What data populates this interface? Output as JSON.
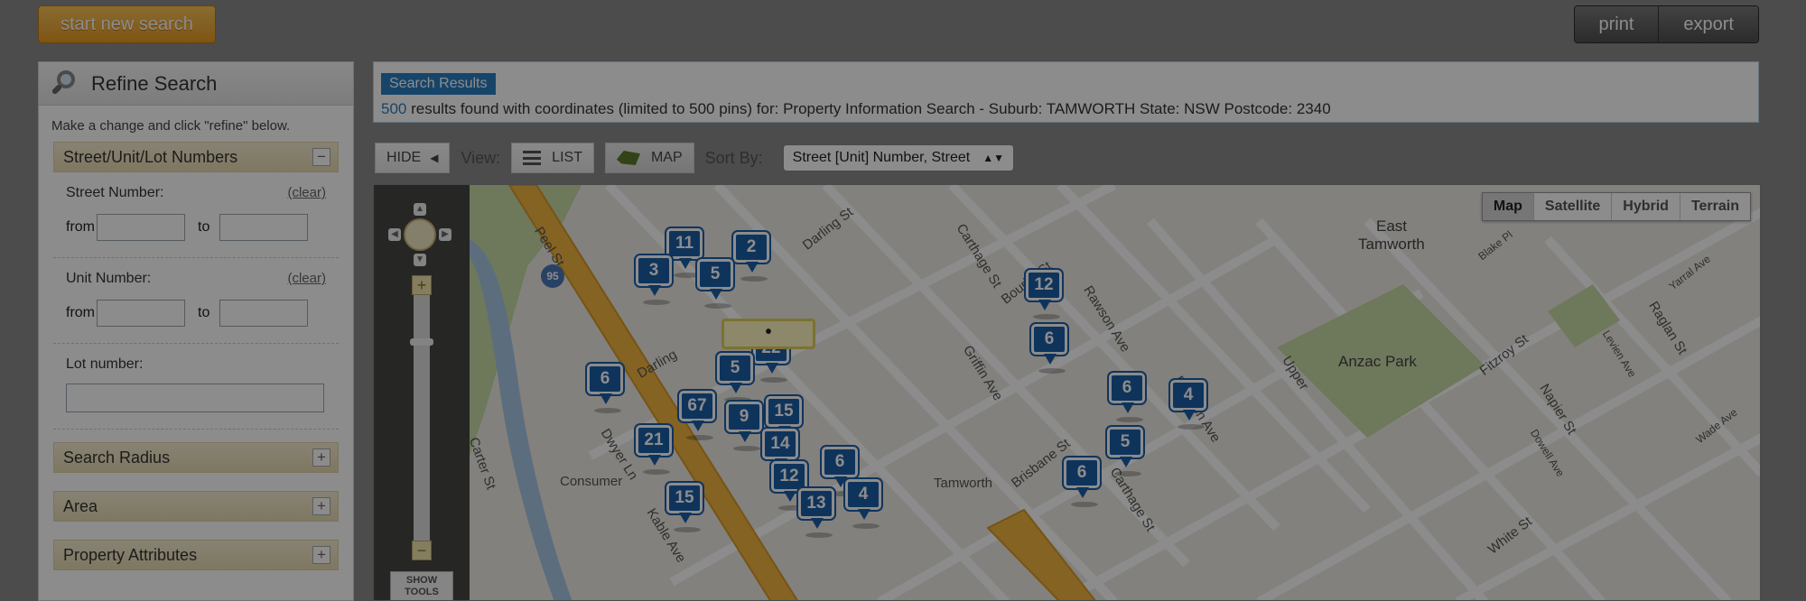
{
  "topbar": {
    "new_search": "start new search",
    "print": "print",
    "export": "export"
  },
  "refine": {
    "title": "Refine Search",
    "hint": "Make a change and click \"refine\" below.",
    "street_section": "Street/Unit/Lot Numbers",
    "street_number_label": "Street Number:",
    "unit_number_label": "Unit Number:",
    "clear": "(clear)",
    "from": "from",
    "to": "to",
    "lot_label": "Lot number:",
    "radius_section": "Search Radius",
    "area_section": "Area",
    "attributes_section": "Property Attributes",
    "minus": "−",
    "plus": "+"
  },
  "results": {
    "tag": "Search Results",
    "count": "500",
    "text": " results found with coordinates (limited to 500 pins) for: Property Information Search - Suburb: TAMWORTH State: NSW Postcode: 2340"
  },
  "view": {
    "hide": "HIDE",
    "view_label": "View:",
    "list": "LIST",
    "map": "MAP",
    "sort_label": "Sort By:",
    "sort_value": "Street [Unit] Number, Street"
  },
  "map": {
    "types": [
      "Map",
      "Satellite",
      "Hybrid",
      "Terrain"
    ],
    "selected_type": "Map",
    "show_tools": "SHOW TOOLS",
    "bubble": "•",
    "highway_shield": "95",
    "labels": {
      "peel": "Peel St",
      "darling_st": "Darling St",
      "darling": "Darling",
      "carthage1": "Carthage St",
      "bourke": "Bourke St",
      "rawson": "Rawson Ave",
      "griffin": "Griffin Ave",
      "brisbane": "Brisbane St",
      "carthage2": "Carthage St",
      "rawson2": "Rawson Ave",
      "east": "East",
      "east_tamworth": "Tamworth",
      "anzac": "Anzac Park",
      "fitzroy": "Fitzroy St",
      "raglan": "Raglan St",
      "napier": "Napier St",
      "white": "White St",
      "consumer": "Consumer",
      "tamworth": "Tamworth",
      "dwyer": "Dwyer Ln",
      "kable": "Kable Ave",
      "carter": "Carter St",
      "upper": "Upper",
      "blake": "Blake Pl",
      "yarral": "Yarral Ave",
      "dowell": "Dowell Ave",
      "wade": "Wade Ave",
      "levien": "Levien Ave"
    },
    "pins": [
      "11",
      "2",
      "3",
      "5",
      "12",
      "6",
      "22",
      "5",
      "6",
      "6",
      "4",
      "67",
      "9",
      "15",
      "14",
      "21",
      "5",
      "12",
      "6",
      "15",
      "13",
      "4",
      "6"
    ]
  }
}
